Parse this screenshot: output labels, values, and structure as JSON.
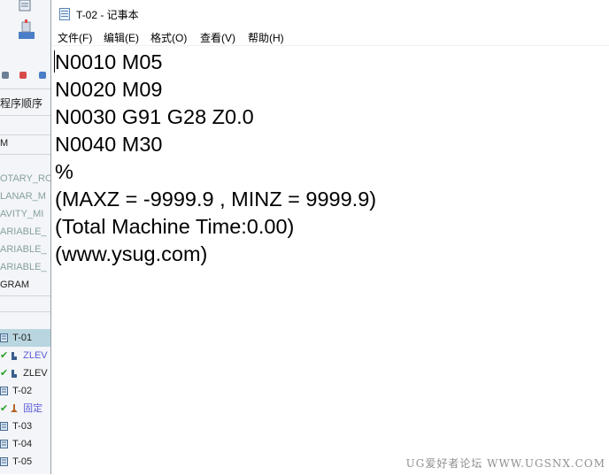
{
  "background_app": {
    "panel_title": "程序顺序",
    "rows": [
      {
        "label": "M",
        "style": "normal"
      },
      {
        "label": "OTARY_RO",
        "style": "grey"
      },
      {
        "label": "LANAR_M",
        "style": "grey"
      },
      {
        "label": "AVITY_MI",
        "style": "grey"
      },
      {
        "label": "ARIABLE_",
        "style": "grey"
      },
      {
        "label": "ARIABLE_",
        "style": "grey"
      },
      {
        "label": "ARIABLE_",
        "style": "grey"
      },
      {
        "label": "GRAM",
        "style": "normal"
      }
    ],
    "tree": [
      {
        "label": "T-01",
        "type": "program",
        "selected": true
      },
      {
        "label": "ZLEV",
        "type": "operation",
        "color": "blue"
      },
      {
        "label": "ZLEV",
        "type": "operation",
        "color": "black"
      },
      {
        "label": "T-02",
        "type": "program"
      },
      {
        "label": "固定",
        "type": "operation-fixed",
        "color": "blue"
      },
      {
        "label": "T-03",
        "type": "program"
      },
      {
        "label": "T-04",
        "type": "program"
      },
      {
        "label": "T-05",
        "type": "program"
      }
    ]
  },
  "notepad": {
    "title": "T-02 - 记事本",
    "menu": [
      "文件(F)",
      "编辑(E)",
      "格式(O)",
      "查看(V)",
      "帮助(H)"
    ],
    "lines": [
      "N0010 M05",
      "N0020 M09",
      "N0030 G91 G28 Z0.0",
      "N0040 M30",
      "%",
      "(MAXZ = -9999.9 , MINZ = 9999.9)",
      "(Total Machine Time:0.00)",
      "(www.ysug.com)"
    ]
  },
  "watermark": "UG爱好者论坛 WWW.UGSNX.COM",
  "colors": {
    "selected_row": "#b9d6e0",
    "grey_text": "#86a0a0",
    "check_green": "#2aa02a",
    "operation_blue": "#5b5bd6"
  }
}
